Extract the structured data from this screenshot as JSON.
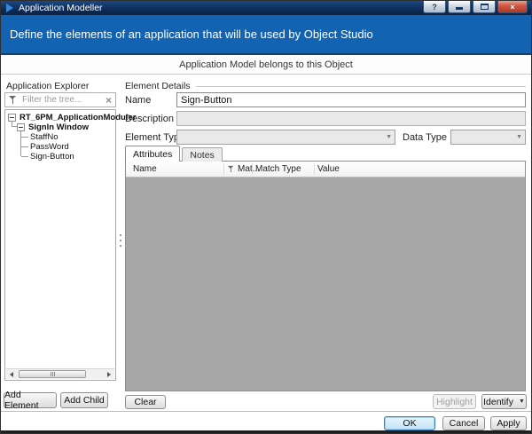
{
  "window": {
    "title": "Application Modeller",
    "controls": {
      "help": "?",
      "close": "×"
    }
  },
  "header": {
    "text": "Define the elements of an application that will be used by Object Studio"
  },
  "subheader": {
    "text": "Application Model belongs to this Object"
  },
  "explorer": {
    "title": "Application Explorer",
    "filter_placeholder": "Filter the tree...",
    "clear_filter": "×",
    "tree": [
      {
        "label": "RT_6PM_ApplicationModuler",
        "level": 0,
        "expanded": true
      },
      {
        "label": "SignIn Window",
        "level": 1,
        "expanded": true
      },
      {
        "label": "StaffNo",
        "level": 2
      },
      {
        "label": "PassWord",
        "level": 2
      },
      {
        "label": "Sign-Button",
        "level": 2
      }
    ],
    "buttons": {
      "add_element": "Add Element",
      "add_child": "Add Child"
    }
  },
  "details": {
    "section_title": "Element Details",
    "name_label": "Name",
    "name_value": "Sign-Button",
    "description_label": "Description",
    "description_value": "",
    "element_type_label": "Element Type",
    "element_type_value": "",
    "data_type_label": "Data Type",
    "data_type_value": "",
    "tabs": [
      {
        "label": "Attributes",
        "active": true
      },
      {
        "label": "Notes",
        "active": false
      }
    ],
    "table": {
      "columns": [
        "Name",
        "Mat...",
        "Match Type",
        "Value"
      ],
      "rows": []
    },
    "buttons": {
      "clear": "Clear",
      "highlight": "Highlight",
      "identify": "Identify"
    }
  },
  "footer": {
    "ok": "OK",
    "cancel": "Cancel",
    "apply": "Apply"
  },
  "icons": {
    "dropdown_arrow": "▼"
  },
  "colors": {
    "titlebar_bg": "#0d2b55",
    "header_bg": "#1263b2",
    "close_red": "#c24a35",
    "table_body_gray": "#a7a7a7",
    "ok_border_blue": "#3c7fb1"
  }
}
